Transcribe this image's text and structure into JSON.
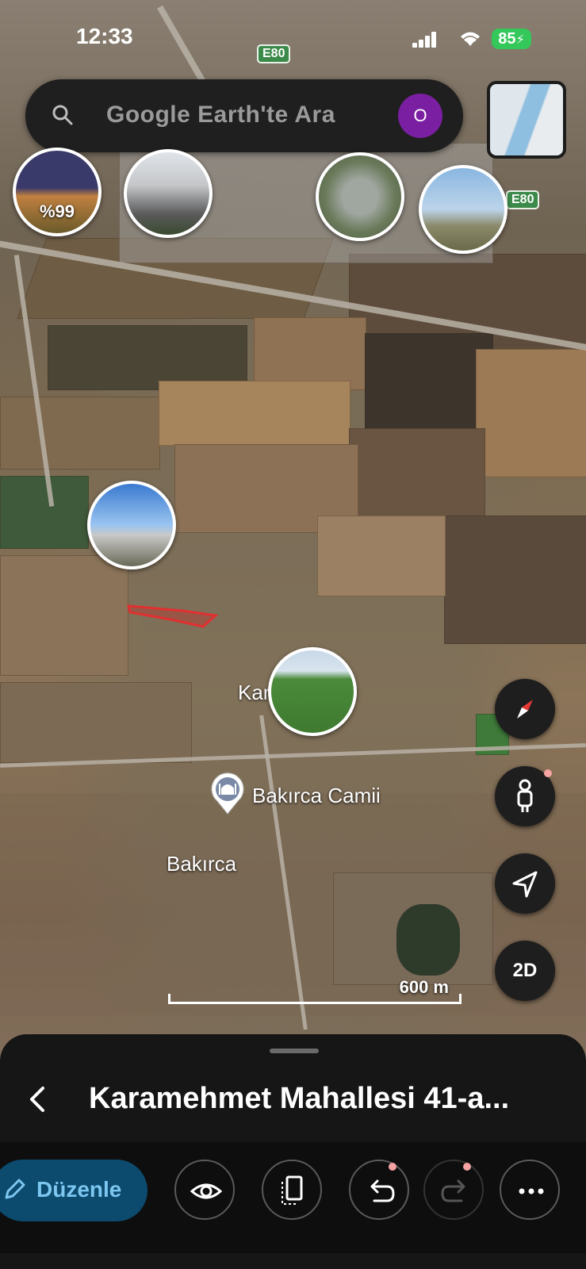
{
  "status_bar": {
    "time": "12:33",
    "battery": "85"
  },
  "map": {
    "highway_labels": [
      "E80",
      "E80"
    ],
    "photo_captions": [
      "%99"
    ],
    "place_labels": {
      "neighborhood": "Karamehmet",
      "mosque": "Bakırca Camii",
      "village": "Bakırca"
    },
    "scale_label": "600 m"
  },
  "search": {
    "placeholder": "Google Earth'te Ara",
    "avatar_initial": "O"
  },
  "controls": {
    "view_mode": "2D"
  },
  "bottom_sheet": {
    "title": "Karamehmet Mahallesi 41-a...",
    "edit_label": "Düzenle"
  },
  "colors": {
    "accent": "#7cc6f0",
    "edit_bg": "#0c4a6e",
    "avatar": "#7b1fa2",
    "battery": "#34c759",
    "highway": "#3c8a4a"
  }
}
